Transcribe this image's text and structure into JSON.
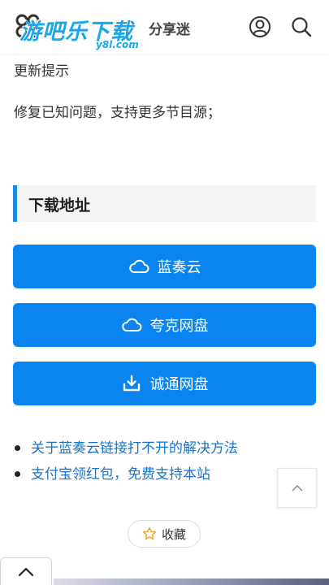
{
  "header": {
    "logo_text": "游吧乐下载",
    "logo_sub": "y8l.com",
    "logo_tail": "分享迷"
  },
  "update": {
    "title": "更新提示",
    "text": "修复已知问题，支持更多节目源；"
  },
  "download": {
    "heading": "下载地址",
    "buttons": [
      {
        "label": "蓝奏云",
        "icon": "cloud-icon"
      },
      {
        "label": "夸克网盘",
        "icon": "cloud-icon"
      },
      {
        "label": "诚通网盘",
        "icon": "download-icon"
      }
    ]
  },
  "links": [
    "关于蓝奏云链接打不开的解决方法",
    "支付宝领红包，免费支持本站"
  ],
  "collect": {
    "label": "收藏",
    "icon": "star-icon"
  },
  "colors": {
    "accent": "#0a84f0",
    "link": "#1a73c8",
    "heading_bar": "#1e88e5",
    "logo": "#1aa7ea",
    "star": "#f5a623"
  }
}
